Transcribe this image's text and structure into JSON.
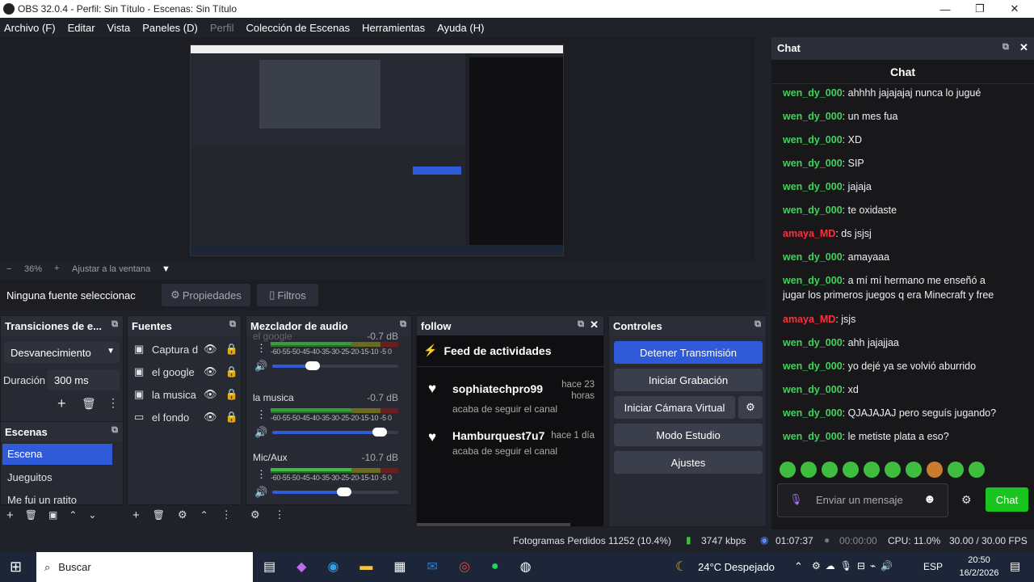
{
  "window": {
    "title": "OBS 32.0.4 - Perfil: Sin Título - Escenas: Sin Título",
    "minimize": "—",
    "restore": "❐",
    "close": "✕"
  },
  "menu": [
    "Archivo (F)",
    "Editar",
    "Vista",
    "Paneles (D)",
    "Perfil",
    "Colección de Escenas",
    "Herramientas",
    "Ayuda (H)"
  ],
  "zoom": {
    "minus": "−",
    "value": "36%",
    "plus": "+",
    "fit": "Ajustar a la ventana",
    "dropdown": "▼"
  },
  "source_bar": {
    "no_source": "Ninguna fuente seleccionac",
    "properties": "Propiedades",
    "filters": "Filtros"
  },
  "transitions": {
    "title": "Transiciones de e...",
    "type": "Desvanecimiento",
    "duration_label": "Duración",
    "duration_value": "300 ms"
  },
  "scenes": {
    "title": "Escenas",
    "items": [
      "Escena",
      "Jueguitos",
      "Me fui un ratito"
    ]
  },
  "sources": {
    "title": "Fuentes",
    "items": [
      "Captura d",
      "el google",
      "la musica",
      "el fondo"
    ]
  },
  "mixer": {
    "title": "Mezclador de audio",
    "tracks": [
      {
        "name": "el google",
        "db": "-0.7 dB",
        "fill": 0.32
      },
      {
        "name": "la musica",
        "db": "-0.7 dB",
        "fill": 0.85
      },
      {
        "name": "Mic/Aux",
        "db": "-10.7 dB",
        "fill": 0.57
      }
    ],
    "ticks": "-60-55-50-45-40-35-30-25-20-15-10 -5 0"
  },
  "follow": {
    "title": "follow",
    "feed_title": "Feed de actividades",
    "events": [
      {
        "user": "sophiatechpro99",
        "action": "acaba de seguir el canal",
        "time": "hace 23 horas"
      },
      {
        "user": "Hamburquest7u7",
        "action": "acaba de seguir el canal",
        "time": "hace 1 día"
      }
    ]
  },
  "controls": {
    "title": "Controles",
    "stop_stream": "Detener Transmisión",
    "start_rec": "Iniciar Grabación",
    "virtual_cam": "Iniciar Cámara Virtual",
    "studio": "Modo Estudio",
    "settings": "Ajustes",
    "accent": "#2f5ad8"
  },
  "chat": {
    "dock_title": "Chat",
    "header": "Chat",
    "placeholder": "Enviar un mensaje",
    "send": "Chat",
    "name_color": "#3fd35b",
    "alt_name_color": "#ff2f3b",
    "messages": [
      {
        "user": "wen_dy_000",
        "text": "ahhhh jajajajaj nunca lo jugué",
        "alt": false
      },
      {
        "user": "wen_dy_000",
        "text": "un mes fua",
        "alt": false
      },
      {
        "user": "wen_dy_000",
        "text": "XD",
        "alt": false
      },
      {
        "user": "wen_dy_000",
        "text": "SIP",
        "alt": false
      },
      {
        "user": "wen_dy_000",
        "text": "jajaja",
        "alt": false
      },
      {
        "user": "wen_dy_000",
        "text": "te oxidaste",
        "alt": false
      },
      {
        "user": "amaya_MD",
        "text": "ds jsjsj",
        "alt": true
      },
      {
        "user": "wen_dy_000",
        "text": "amayaaa",
        "alt": false
      },
      {
        "user": "wen_dy_000",
        "text": "a mí mí hermano me enseñó a jugar los primeros juegos q era Minecraft y free",
        "alt": false
      },
      {
        "user": "amaya_MD",
        "text": "jsjs",
        "alt": true
      },
      {
        "user": "wen_dy_000",
        "text": "ahh jajajjaa",
        "alt": false
      },
      {
        "user": "wen_dy_000",
        "text": "yo dejé ya se volvió aburrido",
        "alt": false
      },
      {
        "user": "wen_dy_000",
        "text": "xd",
        "alt": false
      },
      {
        "user": "wen_dy_000",
        "text": "QJAJAJAJ pero seguís jugando?",
        "alt": false
      },
      {
        "user": "wen_dy_000",
        "text": "le metiste plata a eso?",
        "alt": false
      }
    ]
  },
  "status": {
    "dropped": "Fotogramas Perdidos 11252 (10.4%)",
    "bitrate": "3747 kbps",
    "stream_time": "01:07:37",
    "rec_time": "00:00:00",
    "cpu": "CPU: 11.0%",
    "fps": "30.00 / 30.00 FPS"
  },
  "taskbar": {
    "search": "Buscar",
    "weather": "24°C  Despejado",
    "lang": "ESP",
    "time": "20:50",
    "date": "16/2/2026"
  }
}
